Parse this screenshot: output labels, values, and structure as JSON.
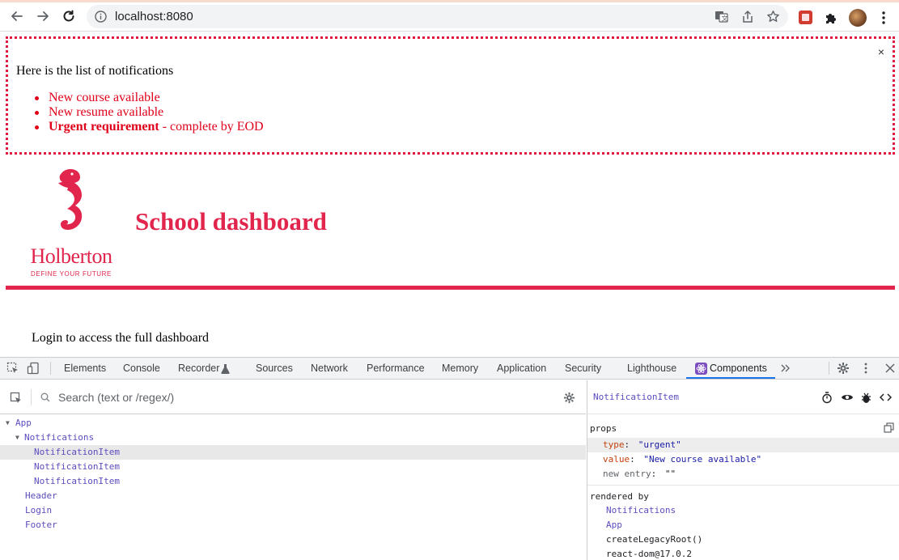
{
  "browser": {
    "url": "localhost:8080"
  },
  "notifications": {
    "close_label": "×",
    "title": "Here is the list of notifications",
    "items": [
      {
        "text": "New course available",
        "type": "default"
      },
      {
        "text": "New resume available",
        "type": "default"
      },
      {
        "strong": "Urgent requirement",
        "rest": " - complete by EOD",
        "type": "urgent"
      }
    ]
  },
  "header": {
    "logo_word": "Holberton",
    "logo_tagline": "DEFINE YOUR FUTURE",
    "title": "School dashboard",
    "accent_color": "#e1254c"
  },
  "body": {
    "login_text": "Login to access the full dashboard"
  },
  "devtools": {
    "tabs": [
      "Elements",
      "Console",
      "Recorder",
      "Sources",
      "Network",
      "Performance",
      "Memory",
      "Application",
      "Security",
      "Lighthouse",
      "Components"
    ],
    "active_tab": "Components",
    "search_placeholder": "Search (text or /regex/)",
    "tree": [
      {
        "label": "App",
        "depth": 0,
        "expanded": true
      },
      {
        "label": "Notifications",
        "depth": 1,
        "expanded": true
      },
      {
        "label": "NotificationItem",
        "depth": 2,
        "selected": true
      },
      {
        "label": "NotificationItem",
        "depth": 2
      },
      {
        "label": "NotificationItem",
        "depth": 2
      },
      {
        "label": "Header",
        "depth": 1
      },
      {
        "label": "Login",
        "depth": 1
      },
      {
        "label": "Footer",
        "depth": 1
      }
    ],
    "inspector": {
      "component": "NotificationItem",
      "props_heading": "props",
      "props": [
        {
          "key": "type",
          "value": "\"urgent\""
        },
        {
          "key": "value",
          "value": "\"New course available\""
        },
        {
          "key": "new entry",
          "value": "\"\""
        }
      ],
      "rendered_by_heading": "rendered by",
      "rendered_by": [
        "Notifications",
        "App",
        "createLegacyRoot()",
        "react-dom@17.0.2"
      ]
    }
  }
}
